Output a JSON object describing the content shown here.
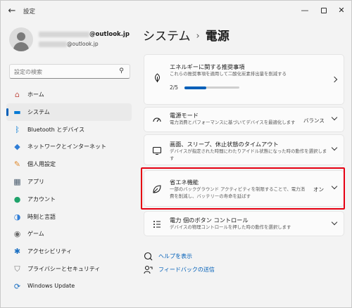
{
  "window": {
    "title": "設定",
    "back_glyph": "←",
    "min_glyph": "—",
    "close_glyph": "✕"
  },
  "account": {
    "email_suffix": "@outlook.jp",
    "sub_suffix": "@outlook.jp"
  },
  "search": {
    "placeholder": "設定の検索"
  },
  "nav": [
    {
      "label": "ホーム",
      "icon": "home-icon",
      "glyph": "⌂",
      "color": "#c4554d",
      "active": false
    },
    {
      "label": "システム",
      "icon": "system-icon",
      "glyph": "▬",
      "color": "#0078d4",
      "active": true
    },
    {
      "label": "Bluetooth とデバイス",
      "icon": "bluetooth-icon",
      "glyph": "ᛒ",
      "color": "#0078d4",
      "active": false
    },
    {
      "label": "ネットワークとインターネット",
      "icon": "wifi-icon",
      "glyph": "◆",
      "color": "#2f7dd6",
      "active": false
    },
    {
      "label": "個人用設定",
      "icon": "brush-icon",
      "glyph": "✎",
      "color": "#e08a2e",
      "active": false
    },
    {
      "label": "アプリ",
      "icon": "apps-icon",
      "glyph": "▦",
      "color": "#4b5d6e",
      "active": false
    },
    {
      "label": "アカウント",
      "icon": "account-icon",
      "glyph": "●",
      "color": "#1fa36b",
      "active": false
    },
    {
      "label": "時刻と言語",
      "icon": "time-language-icon",
      "glyph": "◑",
      "color": "#2f7dd6",
      "active": false
    },
    {
      "label": "ゲーム",
      "icon": "gaming-icon",
      "glyph": "◉",
      "color": "#6b6b6b",
      "active": false
    },
    {
      "label": "アクセシビリティ",
      "icon": "accessibility-icon",
      "glyph": "✱",
      "color": "#1a6fc2",
      "active": false
    },
    {
      "label": "プライバシーとセキュリティ",
      "icon": "shield-icon",
      "glyph": "⛉",
      "color": "#7a7a7a",
      "active": false
    },
    {
      "label": "Windows Update",
      "icon": "windows-update-icon",
      "glyph": "⟳",
      "color": "#1a6fc2",
      "active": false
    }
  ],
  "breadcrumb": {
    "parent": "システム",
    "separator": "›",
    "current": "電源"
  },
  "cards": {
    "energy": {
      "title": "エネルギーに関する推奨事項",
      "desc": "これらの推奨事項を適用して二酸化炭素排出量を削減する",
      "progress_label": "2/5",
      "progress_fraction": 0.4,
      "icon": "leaf-icon",
      "glyph": "♢"
    },
    "power_mode": {
      "title": "電源モード",
      "desc": "電力消費とパフォーマンスに基づいてデバイスを最適化します",
      "value": "バランス",
      "icon": "power-mode-icon",
      "glyph": "⌁"
    },
    "screen_sleep": {
      "title": "画面、スリープ、休止状態のタイムアウト",
      "desc": "デバイスが指定された時間にわたりアイドル状態になった時の動作を選択します",
      "icon": "screen-sleep-icon",
      "glyph": "▭"
    },
    "energy_saver": {
      "title": "省エネ機能",
      "desc": "一部のバックグラウンド アクティビティを制限することで、電力消費を削減し、バッテリーの寿命を延ばす",
      "value": "オン",
      "icon": "energy-saver-icon",
      "glyph": "♧"
    },
    "power_button": {
      "title": "電力 個のボタン コントロール",
      "desc": "デバイスの物理コントロールを押した時の動作を選択します",
      "icon": "power-button-icon",
      "glyph": "☰"
    }
  },
  "links": {
    "help": "ヘルプを表示",
    "feedback": "フィードバックの送信"
  },
  "colors": {
    "accent": "#005fb8",
    "highlight": "#e60012"
  }
}
